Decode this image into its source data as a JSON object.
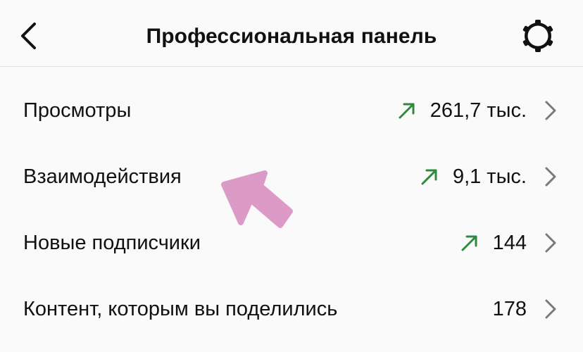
{
  "header": {
    "title": "Профессиональная панель",
    "back_icon": "chevron-left-icon",
    "settings_icon": "gear-icon"
  },
  "rows": [
    {
      "label": "Просмотры",
      "value": "261,7 тыс.",
      "trend": "up"
    },
    {
      "label": "Взаимодействия",
      "value": "9,1 тыс.",
      "trend": "up"
    },
    {
      "label": "Новые подписчики",
      "value": "144",
      "trend": "up"
    },
    {
      "label": "Контент, которым вы поделились",
      "value": "178",
      "trend": "none"
    }
  ],
  "colors": {
    "background": "#fafafa",
    "text": "#111111",
    "trend_up": "#2e8b3d",
    "chevron": "#7a7a7a",
    "annotation_arrow": "#dc9ac6"
  }
}
